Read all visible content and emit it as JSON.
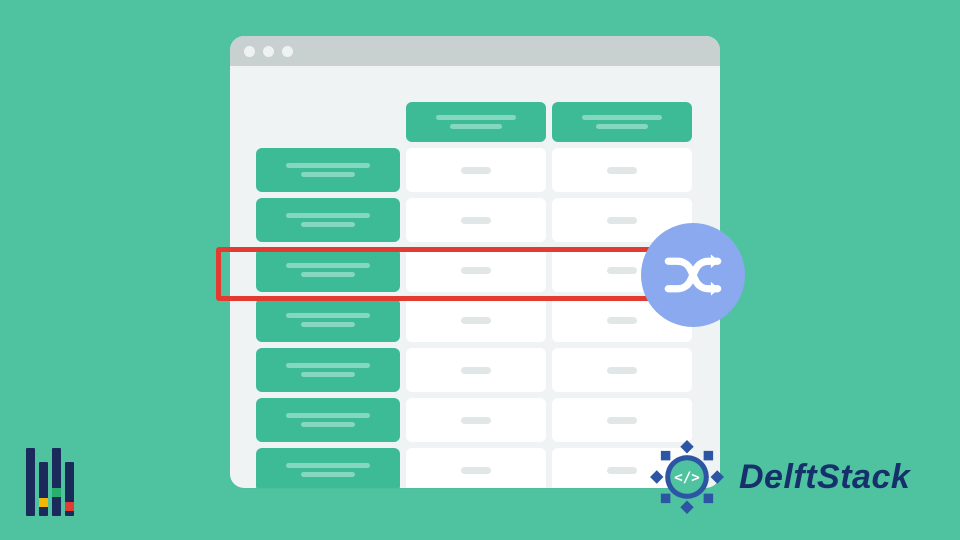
{
  "brand": {
    "name": "DelftStack"
  },
  "icons": {
    "window_dots": 3,
    "shuffle": "shuffle-icon",
    "delft_badge": "code-medallion-icon",
    "bottom_left": "pandas-bars-logo"
  },
  "colors": {
    "bg": "#4fc3a0",
    "accent": "#3cbb96",
    "highlight": "#e33b2f",
    "shuffle_bg": "#8aa9ef",
    "brand_text": "#15306a"
  },
  "table": {
    "columns": 2,
    "rows": 7,
    "highlighted_row_index": 2
  }
}
